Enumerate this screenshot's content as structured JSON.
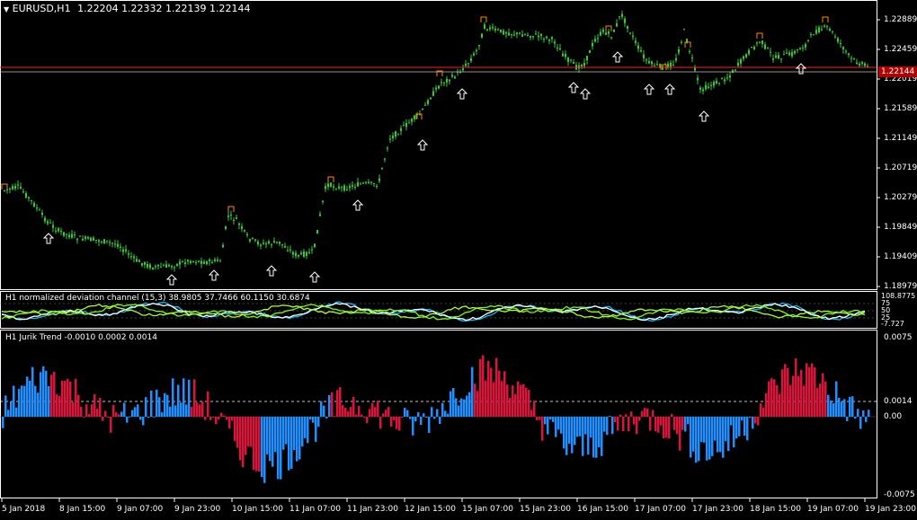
{
  "main": {
    "title_symbol": "EURUSD,H1",
    "ohlc": "1.22204 1.22332 1.22139 1.22144",
    "current_price": "1.22144",
    "price_labels": [
      "1.22889",
      "1.22459",
      "1.22019",
      "1.21589",
      "1.21149",
      "1.20719",
      "1.20279",
      "1.19849",
      "1.19409",
      "1.18979"
    ],
    "colors": {
      "bull": "#32cd32",
      "bear": "#32cd32",
      "price_line": "#ff2020",
      "arrow": "#ffffff",
      "marker": "#ff8c00"
    }
  },
  "ndc": {
    "title": "H1  normalized deviation channel (15,3) 38.9805 37.7466 60.1150 30.6874",
    "levels": [
      "108.8775",
      "75",
      "50",
      "25",
      "-7.727"
    ],
    "colors": {
      "line1": "#00bfff",
      "line2": "#7cfc00",
      "line3": "#ffffff",
      "line4": "#adff2f"
    }
  },
  "jurik": {
    "title": "H1  Jurik Trend  -0.0010 0.0002 0.0014",
    "levels": [
      "0.0075",
      "0.0014",
      "0.00",
      "-0.0075"
    ],
    "colors": {
      "up": "#1e90ff",
      "down": "#dc143c",
      "dashed": "#ffffff"
    }
  },
  "time_axis": {
    "labels": [
      "5 Jan 2018",
      "8 Jan 15:00",
      "9 Jan 07:00",
      "9 Jan 23:00",
      "10 Jan 15:00",
      "11 Jan 07:00",
      "11 Jan 23:00",
      "12 Jan 15:00",
      "15 Jan 07:00",
      "15 Jan 23:00",
      "16 Jan 15:00",
      "17 Jan 07:00",
      "17 Jan 23:00",
      "18 Jan 15:00",
      "19 Jan 07:00",
      "19 Jan 23:00"
    ]
  }
}
